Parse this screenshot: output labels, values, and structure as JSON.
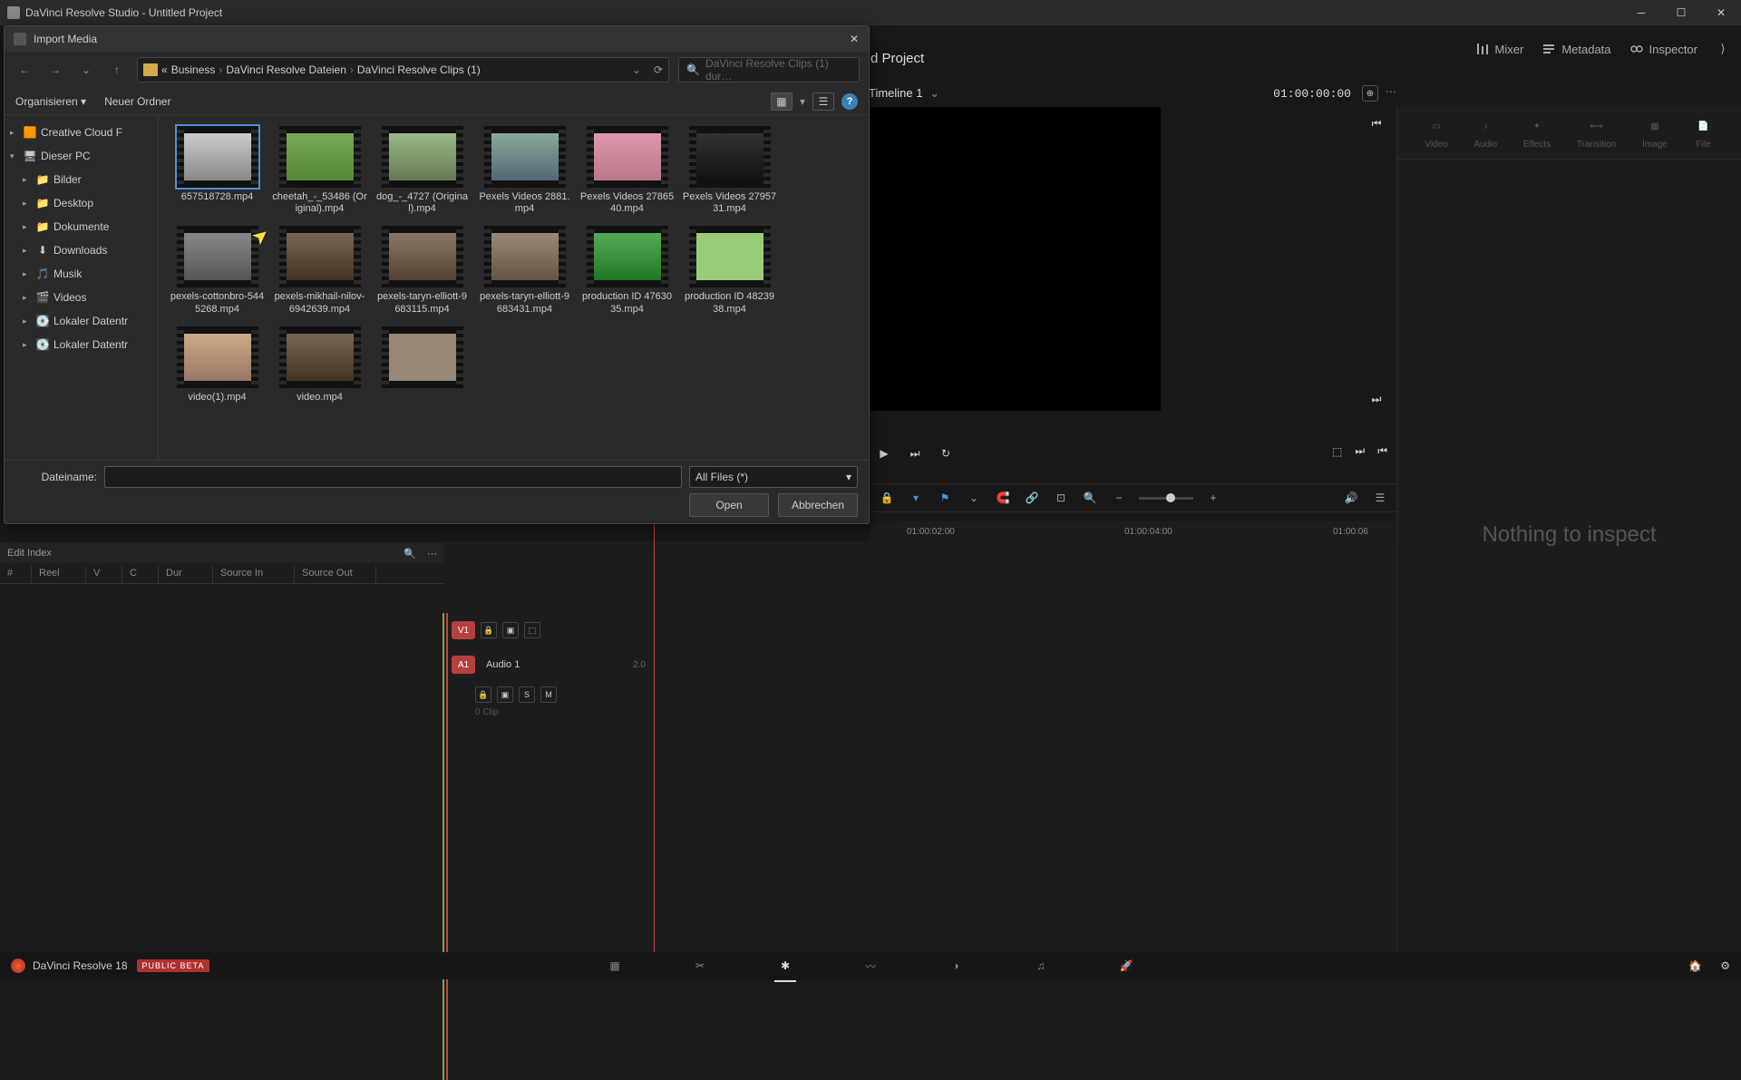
{
  "window_title": "DaVinci Resolve Studio - Untitled Project",
  "project_title": "d Project",
  "timeline_name": "Timeline 1",
  "timecode": "01:00:00:00",
  "top_right": {
    "mixer": "Mixer",
    "metadata": "Metadata",
    "inspector": "Inspector"
  },
  "inspector_tabs": [
    "Video",
    "Audio",
    "Effects",
    "Transition",
    "Image",
    "File"
  ],
  "inspector_empty": "Nothing to inspect",
  "bottom": {
    "app_name": "DaVinci Resolve 18",
    "beta": "PUBLIC BETA"
  },
  "edit_index": {
    "title": "Edit Index",
    "cols": [
      "#",
      "Reel",
      "V",
      "C",
      "Dur",
      "Source In",
      "Source Out"
    ]
  },
  "track_v1": "V1",
  "track_a1_btn": "A1",
  "track_a1_label": "Audio 1",
  "track_a1_fmt": "2.0",
  "track_a1_clips": "0 Clip",
  "solo": "S",
  "mute": "M",
  "ruler": [
    "01:00:02:00",
    "01:00:04:00",
    "01:00:06"
  ],
  "dialog": {
    "title": "Import Media",
    "breadcrumb": {
      "pre": "«",
      "segs": [
        "Business",
        "DaVinci Resolve Dateien",
        "DaVinci Resolve Clips (1)"
      ]
    },
    "search_placeholder": "DaVinci Resolve Clips (1) dur…",
    "organize": "Organisieren",
    "new_folder": "Neuer Ordner",
    "tree": [
      {
        "label": "Creative Cloud F",
        "lvl": 1,
        "icon": "cc"
      },
      {
        "label": "Dieser PC",
        "lvl": 1,
        "icon": "pc",
        "expanded": true
      },
      {
        "label": "Bilder",
        "lvl": 2,
        "icon": "folder-blue"
      },
      {
        "label": "Desktop",
        "lvl": 2,
        "icon": "folder-teal"
      },
      {
        "label": "Dokumente",
        "lvl": 2,
        "icon": "folder"
      },
      {
        "label": "Downloads",
        "lvl": 2,
        "icon": "download"
      },
      {
        "label": "Musik",
        "lvl": 2,
        "icon": "music"
      },
      {
        "label": "Videos",
        "lvl": 2,
        "icon": "video"
      },
      {
        "label": "Lokaler Datentr",
        "lvl": 2,
        "icon": "disk"
      },
      {
        "label": "Lokaler Datentr",
        "lvl": 2,
        "icon": "disk"
      }
    ],
    "files": [
      {
        "name": "657518728.mp4",
        "sel": true
      },
      {
        "name": "cheetah_-_53486 (Original).mp4"
      },
      {
        "name": "dog_-_4727 (Original).mp4"
      },
      {
        "name": "Pexels Videos 2881.mp4"
      },
      {
        "name": "Pexels Videos 2786540.mp4"
      },
      {
        "name": "Pexels Videos 2795731.mp4"
      },
      {
        "name": "pexels-cottonbro-5445268.mp4"
      },
      {
        "name": "pexels-mikhail-nilov-6942639.mp4"
      },
      {
        "name": "pexels-taryn-elliott-9683115.mp4"
      },
      {
        "name": "pexels-taryn-elliott-9683431.mp4"
      },
      {
        "name": "production ID 4763035.mp4"
      },
      {
        "name": "production ID 4823938.mp4"
      },
      {
        "name": "video(1).mp4"
      },
      {
        "name": "video.mp4"
      }
    ],
    "fname_label": "Dateiname:",
    "fname_value": "",
    "filter": "All Files (*)",
    "open": "Open",
    "cancel": "Abbrechen"
  }
}
